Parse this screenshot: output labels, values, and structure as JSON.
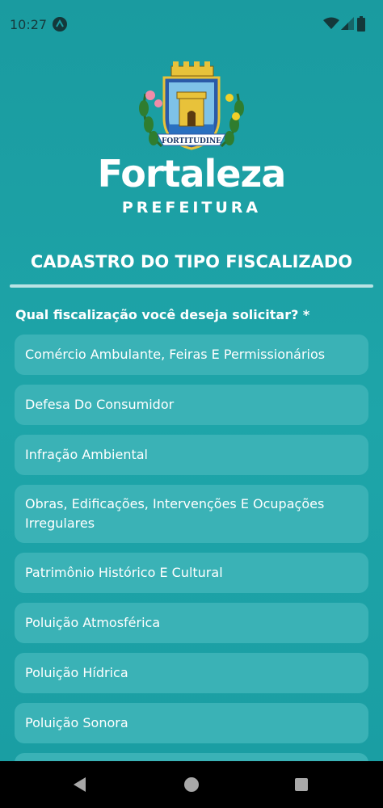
{
  "status_bar": {
    "time": "10:27",
    "app_icon": "arrow-up-circle-icon",
    "wifi_icon": "wifi-icon",
    "signal_icon": "cell-signal-icon",
    "battery_icon": "battery-icon"
  },
  "header": {
    "crest_motto": "FORTITUDINE",
    "brand_name": "Fortaleza",
    "brand_sub": "PREFEITURA"
  },
  "page_title": "CADASTRO DO TIPO FISCALIZADO",
  "question": "Qual fiscalização você deseja solicitar? *",
  "options": [
    {
      "label": "Comércio Ambulante, Feiras E Permissionários"
    },
    {
      "label": "Defesa Do Consumidor"
    },
    {
      "label": "Infração Ambiental"
    },
    {
      "label": "Obras, Edificações, Intervenções E Ocupações Irregulares"
    },
    {
      "label": "Patrimônio Histórico E Cultural"
    },
    {
      "label": "Poluição Atmosférica"
    },
    {
      "label": "Poluição Hídrica"
    },
    {
      "label": "Poluição Sonora"
    },
    {
      "label": ""
    }
  ],
  "colors": {
    "background": "#1b9da2",
    "option_bg": "#3ab2b6",
    "divider": "#b9e3e4",
    "text": "#ffffff"
  },
  "nav": {
    "back_icon": "back-triangle-icon",
    "home_icon": "home-circle-icon",
    "recents_icon": "recents-square-icon"
  }
}
